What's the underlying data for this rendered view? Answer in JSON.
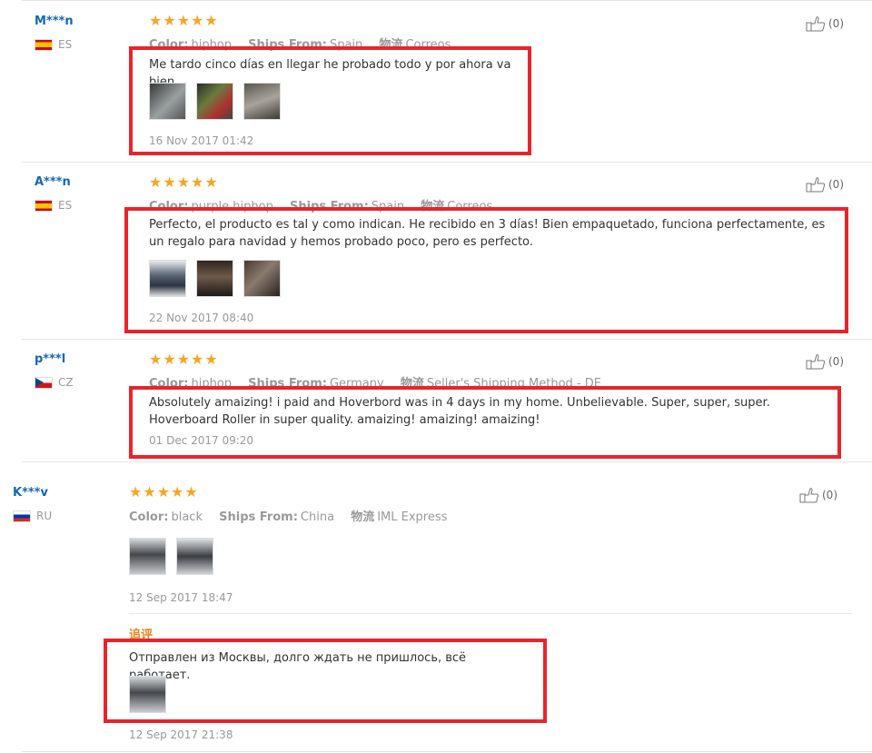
{
  "colors": {
    "highlight": "#e8242b",
    "stars": "#f5a623",
    "username": "#1466b8"
  },
  "reviews": [
    {
      "user": "M***n",
      "country": "ES",
      "flag": "es-flag-icon",
      "stars": "★★★★★",
      "color_label": "Color:",
      "color_value": "hiphop",
      "ships_label": "Ships From:",
      "ships_value": "Spain",
      "logistics_label": "物流",
      "logistics_value": "Correos",
      "text": "Me tardo cinco días en llegar he probado todo y por ahora va bien",
      "date": "16 Nov 2017 01:42",
      "likes": "(0)"
    },
    {
      "user": "A***n",
      "country": "ES",
      "flag": "es-flag-icon",
      "stars": "★★★★★",
      "color_label": "Color:",
      "color_value": "purple hiphop",
      "ships_label": "Ships From:",
      "ships_value": "Spain",
      "logistics_label": "物流",
      "logistics_value": "Correos",
      "text": "Perfecto, el producto es tal y como indican. He recibido en 3 días! Bien empaquetado, funciona perfectamente, es un regalo para navidad y hemos probado poco, pero es perfecto.",
      "date": "22 Nov 2017 08:40",
      "likes": "(0)"
    },
    {
      "user": "p***l",
      "country": "CZ",
      "flag": "cz-flag-icon",
      "stars": "★★★★★",
      "color_label": "Color:",
      "color_value": "hiphop",
      "ships_label": "Ships From:",
      "ships_value": "Germany",
      "logistics_label": "物流",
      "logistics_value": "Seller's Shipping Method - DE",
      "text": "Absolutely amaizing! i paid and Hoverbord was in 4 days in my home. Unbelievable. Super, super, super. Hoverboard Roller in super quality. amaizing! amaizing! amaizing!",
      "date": "01 Dec 2017 09:20",
      "likes": "(0)"
    },
    {
      "user": "K***v",
      "country": "RU",
      "flag": "ru-flag-icon",
      "stars": "★★★★★",
      "color_label": "Color:",
      "color_value": "black",
      "ships_label": "Ships From:",
      "ships_value": "China",
      "logistics_label": "物流",
      "logistics_value": "IML Express",
      "date": "12 Sep 2017 18:47",
      "likes": "(0)",
      "followup_label": "追评",
      "followup_text": "Отправлен из Москвы, долго ждать не пришлось, всё работает.",
      "followup_date": "12 Sep 2017 21:38"
    }
  ]
}
